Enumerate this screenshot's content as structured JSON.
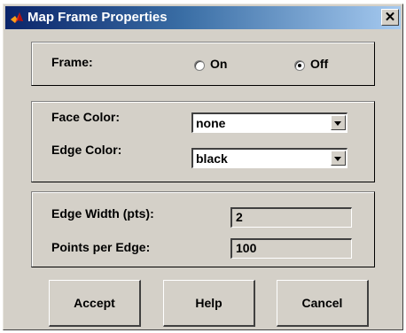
{
  "window": {
    "title": "Map Frame Properties",
    "close_glyph": "✕"
  },
  "frame": {
    "label": "Frame:",
    "options": [
      {
        "label": "On",
        "selected": false
      },
      {
        "label": "Off",
        "selected": true
      }
    ]
  },
  "colors": {
    "face_label": "Face Color:",
    "face_value": "none",
    "edge_label": "Edge Color:",
    "edge_value": "black"
  },
  "edge": {
    "width_label": "Edge Width (pts):",
    "width_value": "2",
    "points_label": "Points per Edge:",
    "points_value": "100"
  },
  "buttons": {
    "accept": "Accept",
    "help": "Help",
    "cancel": "Cancel"
  },
  "theme": {
    "face": "#d4d0c8",
    "title_start": "#0a246a",
    "title_end": "#a6caf0"
  }
}
